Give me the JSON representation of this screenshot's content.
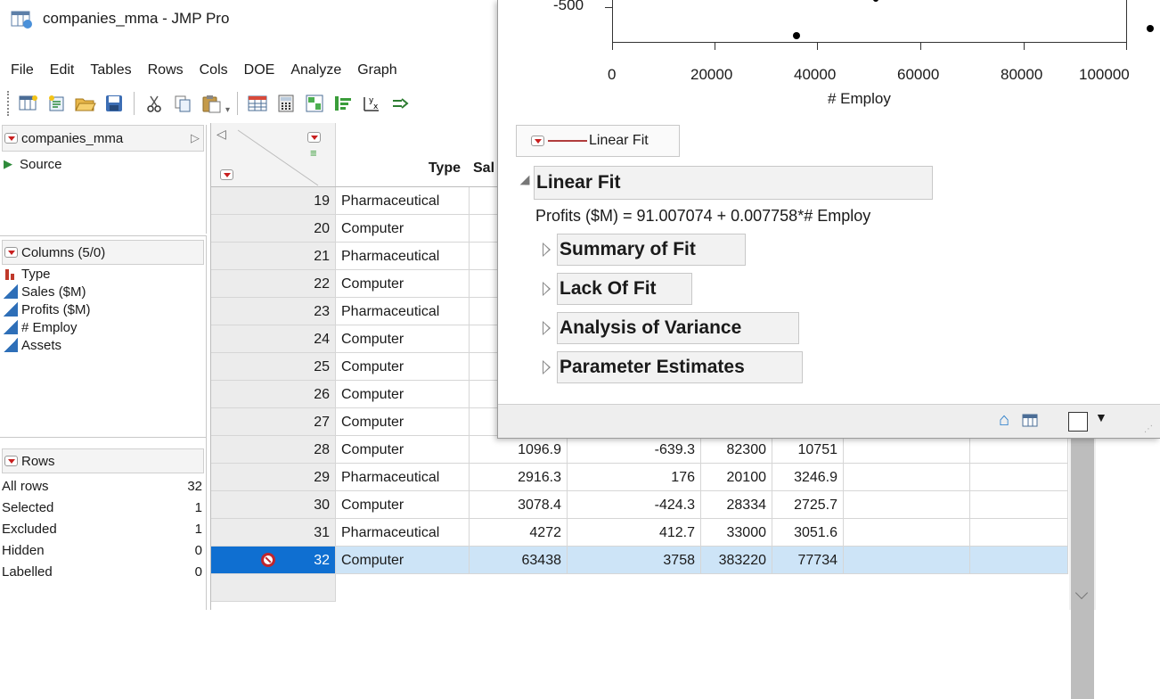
{
  "window": {
    "title": "companies_mma - JMP Pro"
  },
  "menu": [
    "File",
    "Edit",
    "Tables",
    "Rows",
    "Cols",
    "DOE",
    "Analyze",
    "Graph"
  ],
  "toolbar_icons": [
    "new-data-table-icon",
    "new-script-icon",
    "open-folder-icon",
    "save-icon",
    "cut-icon",
    "copy-icon",
    "paste-icon",
    "data-grid-icon",
    "calculator-icon",
    "subset-icon",
    "sort-icon",
    "stack-icon",
    "join-icon"
  ],
  "table_panel": {
    "name": "companies_mma",
    "source": "Source"
  },
  "columns_panel": {
    "header": "Columns (5/0)",
    "items": [
      {
        "name": "Type",
        "kind": "nominal"
      },
      {
        "name": "Sales ($M)",
        "kind": "continuous"
      },
      {
        "name": "Profits ($M)",
        "kind": "continuous"
      },
      {
        "name": "# Employ",
        "kind": "continuous"
      },
      {
        "name": "Assets",
        "kind": "continuous"
      }
    ]
  },
  "rows_panel": {
    "header": "Rows",
    "items": [
      {
        "label": "All rows",
        "value": "32"
      },
      {
        "label": "Selected",
        "value": "1"
      },
      {
        "label": "Excluded",
        "value": "1"
      },
      {
        "label": "Hidden",
        "value": "0"
      },
      {
        "label": "Labelled",
        "value": "0"
      }
    ]
  },
  "grid": {
    "headers": {
      "type": "Type",
      "sales": "Sal"
    },
    "rows": [
      {
        "n": "19",
        "type": "Pharmaceutical",
        "sales": "",
        "profit": "",
        "emp": "",
        "assets": ""
      },
      {
        "n": "20",
        "type": "Computer",
        "sales": "",
        "profit": "",
        "emp": "",
        "assets": ""
      },
      {
        "n": "21",
        "type": "Pharmaceutical",
        "sales": "",
        "profit": "",
        "emp": "",
        "assets": ""
      },
      {
        "n": "22",
        "type": "Computer",
        "sales": "",
        "profit": "",
        "emp": "",
        "assets": ""
      },
      {
        "n": "23",
        "type": "Pharmaceutical",
        "sales": "",
        "profit": "",
        "emp": "",
        "assets": ""
      },
      {
        "n": "24",
        "type": "Computer",
        "sales": "",
        "profit": "",
        "emp": "",
        "assets": ""
      },
      {
        "n": "25",
        "type": "Computer",
        "sales": "",
        "profit": "",
        "emp": "",
        "assets": ""
      },
      {
        "n": "26",
        "type": "Computer",
        "sales": "",
        "profit": "",
        "emp": "",
        "assets": ""
      },
      {
        "n": "27",
        "type": "Computer",
        "sales": "",
        "profit": "",
        "emp": "",
        "assets": ""
      },
      {
        "n": "28",
        "type": "Computer",
        "sales": "1096.9",
        "profit": "-639.3",
        "emp": "82300",
        "assets": "10751"
      },
      {
        "n": "29",
        "type": "Pharmaceutical",
        "sales": "2916.3",
        "profit": "176",
        "emp": "20100",
        "assets": "3246.9"
      },
      {
        "n": "30",
        "type": "Computer",
        "sales": "3078.4",
        "profit": "-424.3",
        "emp": "28334",
        "assets": "2725.7"
      },
      {
        "n": "31",
        "type": "Pharmaceutical",
        "sales": "4272",
        "profit": "412.7",
        "emp": "33000",
        "assets": "3051.6"
      },
      {
        "n": "32",
        "type": "Computer",
        "sales": "63438",
        "profit": "3758",
        "emp": "383220",
        "assets": "77734",
        "selected": true,
        "excluded": true
      }
    ]
  },
  "report": {
    "plot": {
      "y_tick": "-500",
      "x_ticks": [
        "0",
        "20000",
        "40000",
        "60000",
        "80000",
        "100000"
      ],
      "x_label": "# Employ"
    },
    "legend_label": "Linear Fit",
    "fit_title": "Linear Fit",
    "equation": "Profits ($M) = 91.007074 + 0.007758*# Employ",
    "sections": [
      "Summary of Fit",
      "Lack Of Fit",
      "Analysis of Variance",
      "Parameter Estimates"
    ]
  },
  "colors": {
    "fit_line": "#b03c3c",
    "selection": "#0f6fd1",
    "selected_row": "#cde4f7"
  }
}
